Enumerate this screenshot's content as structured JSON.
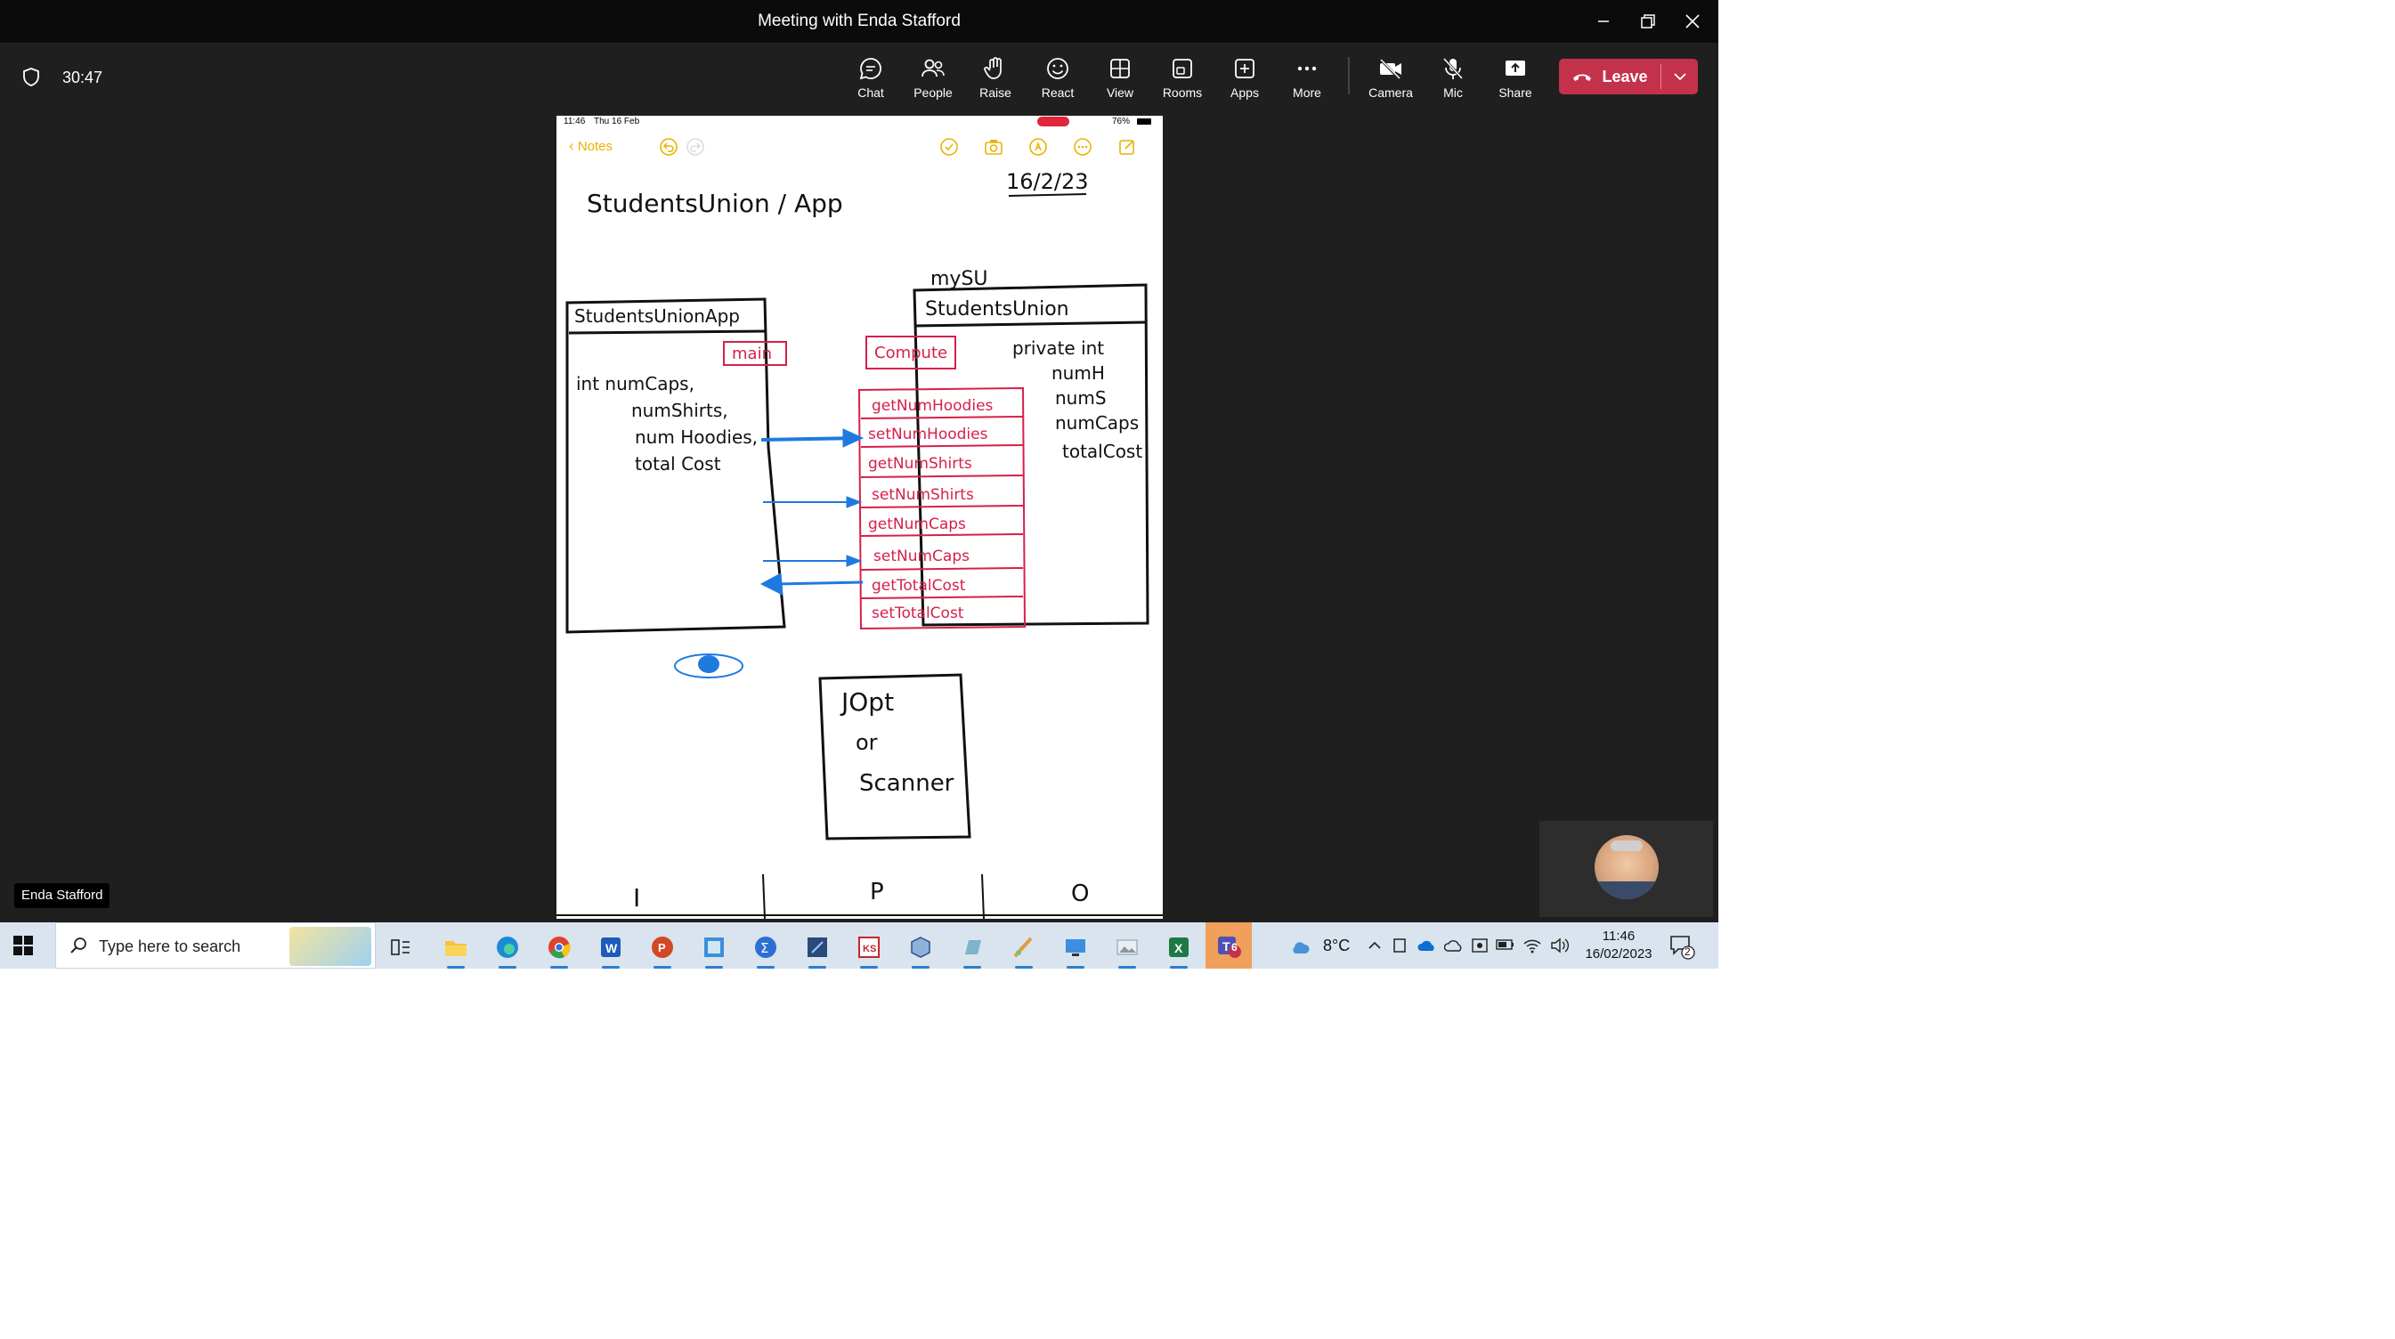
{
  "window": {
    "title": "Meeting with Enda Stafford",
    "minimize_label": "Minimize",
    "restore_label": "Restore",
    "close_label": "Close"
  },
  "toolbar": {
    "timer": "30:47",
    "buttons": [
      {
        "label": "Chat",
        "icon": "chat-icon"
      },
      {
        "label": "People",
        "icon": "people-icon"
      },
      {
        "label": "Raise",
        "icon": "raise-hand-icon"
      },
      {
        "label": "React",
        "icon": "react-icon"
      },
      {
        "label": "View",
        "icon": "view-icon"
      },
      {
        "label": "Rooms",
        "icon": "rooms-icon"
      },
      {
        "label": "Apps",
        "icon": "apps-icon"
      },
      {
        "label": "More",
        "icon": "more-icon"
      },
      {
        "label": "Camera",
        "icon": "camera-off-icon"
      },
      {
        "label": "Mic",
        "icon": "mic-off-icon"
      },
      {
        "label": "Share",
        "icon": "share-icon"
      }
    ],
    "leave_label": "Leave",
    "leave_color": "#c4314b"
  },
  "shared_screen": {
    "status_time": "11:46",
    "status_date": "Thu 16 Feb",
    "battery": "76%",
    "notes_back": "Notes",
    "accent_color": "#e8b400",
    "sketch": {
      "date": "16/2/23",
      "heading": "StudentsUnion / App",
      "mysu_label": "mySU",
      "app_class": "StudentsUnionApp",
      "main_label": "main",
      "app_fields": [
        "int  numCaps,",
        "numShirts,",
        "num Hoodies,",
        "total Cost"
      ],
      "su_class": "StudentsUnion",
      "compute_label": "Compute",
      "su_fields": [
        "private int",
        "numH",
        "numS",
        "numCaps",
        "totalCost"
      ],
      "methods": [
        "getNumHoodies",
        "setNumHoodies",
        "getNumShirts",
        "setNumShirts",
        "getNumCaps",
        "setNumCaps",
        "getTotalCost",
        "setTotalCost"
      ],
      "io_box": [
        "JOpt",
        "or",
        "Scanner"
      ],
      "ipo": [
        "I",
        "P",
        "O"
      ],
      "ink_black": "#111111",
      "ink_red": "#d6204a",
      "ink_blue": "#1f7ae0"
    }
  },
  "participants": {
    "name_tag": "Enda Stafford"
  },
  "taskbar": {
    "search_placeholder": "Type here to search",
    "weather": "8°C",
    "time": "11:46",
    "date": "16/02/2023",
    "notification_count": "2",
    "teams_badge": "6"
  }
}
